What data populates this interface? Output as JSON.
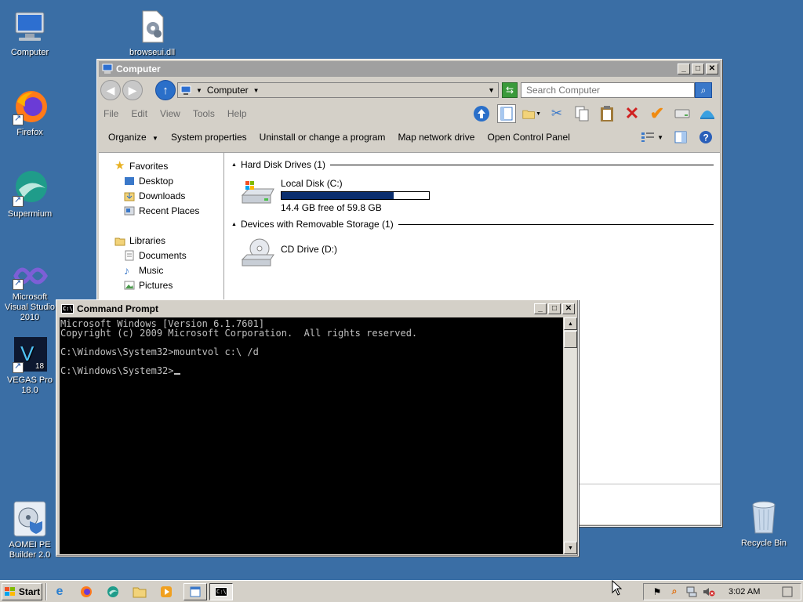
{
  "desktop": {
    "icons": [
      {
        "label": "Computer",
        "icon": "computer-icon"
      },
      {
        "label": "browseui.dll",
        "icon": "dll-file-icon"
      },
      {
        "label": "Firefox",
        "icon": "firefox-icon"
      },
      {
        "label": "Supermium",
        "icon": "supermium-icon"
      },
      {
        "label": "Microsoft Visual Studio 2010",
        "icon": "visual-studio-icon"
      },
      {
        "label": "VEGAS Pro 18.0",
        "icon": "vegas-pro-icon"
      },
      {
        "label": "AOMEI PE Builder 2.0",
        "icon": "aomei-icon"
      },
      {
        "label": "Recycle Bin",
        "icon": "recycle-bin-icon"
      }
    ]
  },
  "explorer": {
    "title": "Computer",
    "address": {
      "crumb": "Computer"
    },
    "search": {
      "placeholder": "Search Computer"
    },
    "menu": [
      "File",
      "Edit",
      "View",
      "Tools",
      "Help"
    ],
    "commands": {
      "organize": "Organize",
      "system_properties": "System properties",
      "uninstall": "Uninstall or change a program",
      "map_drive": "Map network drive",
      "control_panel": "Open Control Panel"
    },
    "nav": {
      "favorites": "Favorites",
      "desktop": "Desktop",
      "downloads": "Downloads",
      "recent": "Recent Places",
      "libraries": "Libraries",
      "documents": "Documents",
      "music": "Music",
      "pictures": "Pictures"
    },
    "groups": {
      "hdd": "Hard Disk Drives (1)",
      "removable": "Devices with Removable Storage (1)"
    },
    "drives": {
      "c": {
        "name": "Local Disk (C:)",
        "free": "14.4 GB free of 59.8 GB",
        "used_fraction": 0.76
      },
      "d": {
        "name": "CD Drive (D:)"
      }
    }
  },
  "cmd": {
    "title": "Command Prompt",
    "lines": [
      "Microsoft Windows [Version 6.1.7601]",
      "Copyright (c) 2009 Microsoft Corporation.  All rights reserved.",
      "",
      "C:\\Windows\\System32>mountvol c:\\ /d",
      "",
      "C:\\Windows\\System32>"
    ]
  },
  "taskbar": {
    "start": "Start",
    "clock": "3:02 AM"
  }
}
